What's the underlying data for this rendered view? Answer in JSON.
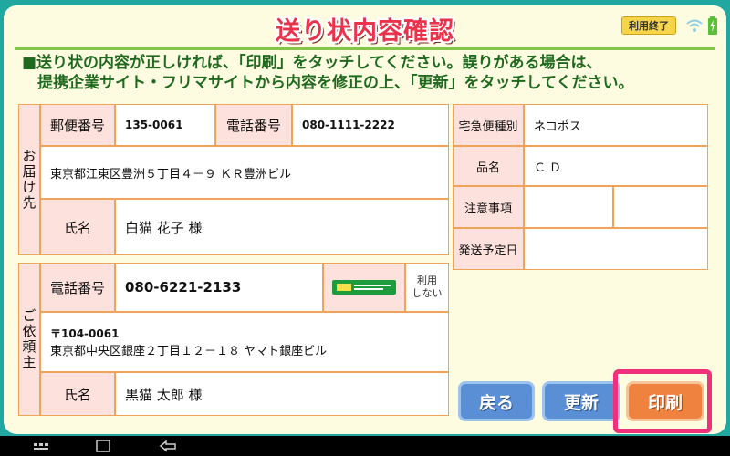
{
  "header": {
    "title": "送り状内容確認",
    "exit_button": "利用終了",
    "icons": [
      "wifi-icon",
      "battery-charging-icon"
    ]
  },
  "instruction": {
    "line1": "■送り状の内容が正しければ、「印刷」をタッチしてください。誤りがある場合は、",
    "line2": "　提携企業サイト・フリマサイトから内容を修正の上、「更新」をタッチしてください。"
  },
  "recipient": {
    "section_label": "お届け先",
    "postal_label": "郵便番号",
    "postal_value": "135-0061",
    "phone_label": "電話番号",
    "phone_value": "080-1111-2222",
    "address": "東京都江東区豊洲５丁目４－９ ＫＲ豊洲ビル",
    "name_label": "氏名",
    "name_value": "白猫 花子 様"
  },
  "sender": {
    "section_label": "ご依頼主",
    "phone_label": "電話番号",
    "phone_value": "080-6221-2133",
    "unused_line1": "利用",
    "unused_line2": "しない",
    "postal": "〒104-0061",
    "address": "東京都中央区銀座２丁目１２－１８ ヤマト銀座ビル",
    "name_label": "氏名",
    "name_value": "黒猫 太郎 様"
  },
  "details": {
    "service_label": "宅急便種別",
    "service_value": "ネコポス",
    "item_label": "品名",
    "item_value": "ＣＤ",
    "notes_label": "注意事項",
    "shipdate_label": "発送予定日"
  },
  "buttons": {
    "back": "戻る",
    "update": "更新",
    "print": "印刷"
  },
  "colors": {
    "frame_teal": "#1fa7a0",
    "title_red": "#e8334a",
    "label_pink": "#fde1dc",
    "border_orange": "#f0a45a",
    "button_blue": "#5a8fd6",
    "button_orange": "#f08240",
    "highlight_pink": "#f0307a"
  }
}
